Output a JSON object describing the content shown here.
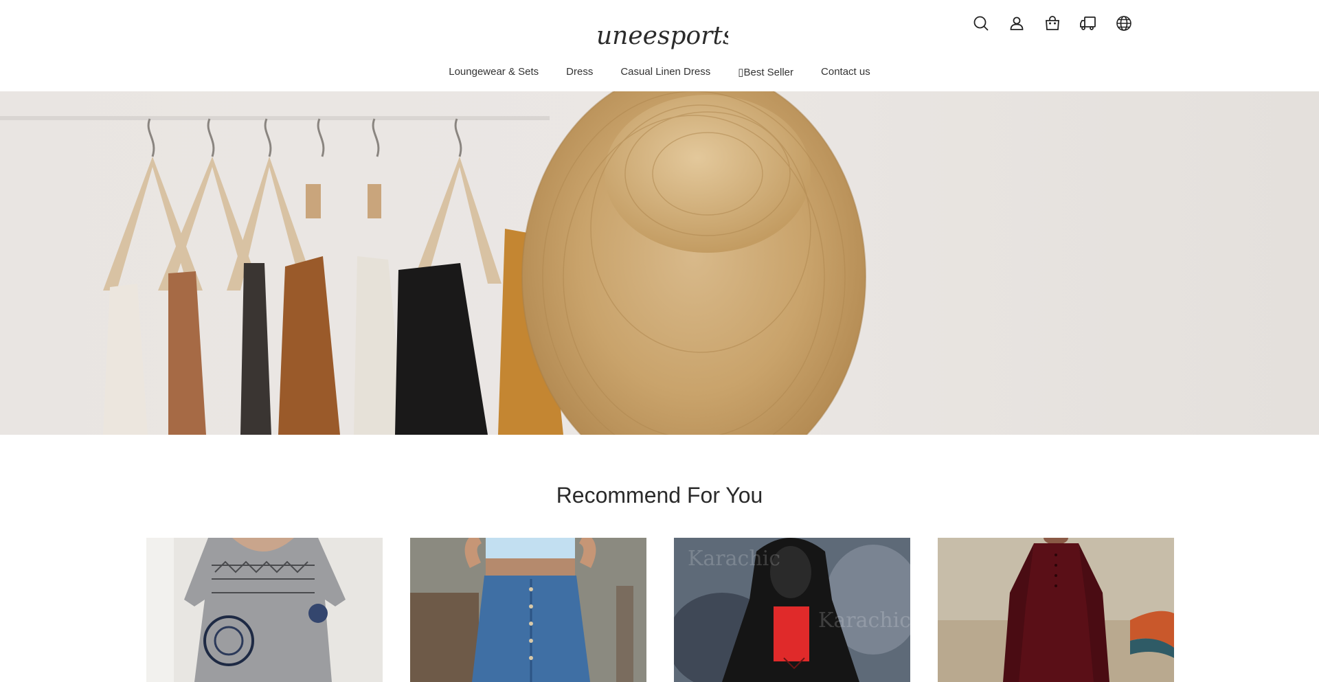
{
  "brand": {
    "logo_text": "uneesports"
  },
  "header_icons": [
    "search-icon",
    "account-icon",
    "cart-icon",
    "order-tracking-icon",
    "language-icon"
  ],
  "nav": {
    "items": [
      {
        "label": "Loungewear & Sets"
      },
      {
        "label": "Dress"
      },
      {
        "label": "Casual Linen Dress"
      },
      {
        "label": "▯Best Seller"
      },
      {
        "label": "Contact us"
      }
    ]
  },
  "section": {
    "title": "Recommend For You"
  },
  "products": [
    {
      "image": "gray-print-tunic-dress"
    },
    {
      "image": "denim-button-skirt"
    },
    {
      "image": "black-red-hooded-top",
      "watermark": "Karachic"
    },
    {
      "image": "burgundy-velvet-dress"
    }
  ]
}
